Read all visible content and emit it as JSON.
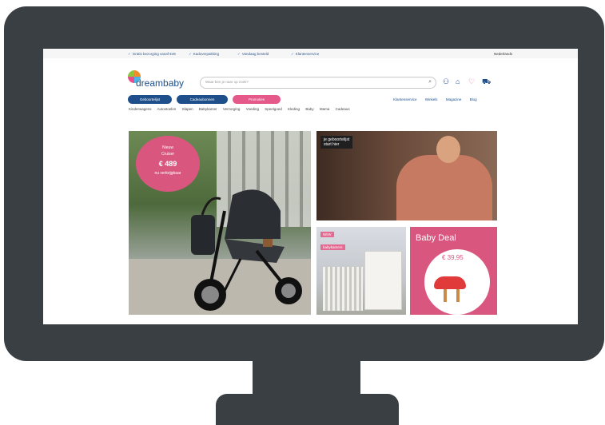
{
  "topbar": {
    "usps": [
      "Gratis bezorging vanaf €49",
      "Kadoverpakking",
      "Vandaag besteld",
      "Klantenservice"
    ],
    "language": "Nederlands"
  },
  "header": {
    "logo_text": "dreambaby",
    "search_placeholder": "Waar ben je naar op zoek?"
  },
  "action_pills": [
    {
      "label": "Geboortelijst",
      "color": "#1e4f8a"
    },
    {
      "label": "Cadeaubonnen",
      "color": "#1e4f8a"
    },
    {
      "label": "Promoties",
      "color": "#e4588a"
    }
  ],
  "top_links": [
    "Klantenservice",
    "Winkels",
    "Magazine",
    "Blog"
  ],
  "category_nav": [
    "Kinderwagens",
    "Autostoelen",
    "Slapen",
    "Babykamer",
    "Verzorging",
    "Voeding",
    "Speelgoed",
    "Kleding",
    "Baby",
    "Mama",
    "Cadeaus"
  ],
  "hero": {
    "badge_line1": "Nieuw",
    "badge_line2": "Cruiser",
    "badge_price": "€ 489",
    "badge_line4": "nu verkrijgbaar"
  },
  "panel_woman": {
    "tag_line1": "je geboortelijst",
    "tag_line2": "start hier"
  },
  "panel_room": {
    "label1": "NEW",
    "label2": "babykamers"
  },
  "panel_deal": {
    "title": "Baby Deal",
    "price": "€ 39,95"
  }
}
